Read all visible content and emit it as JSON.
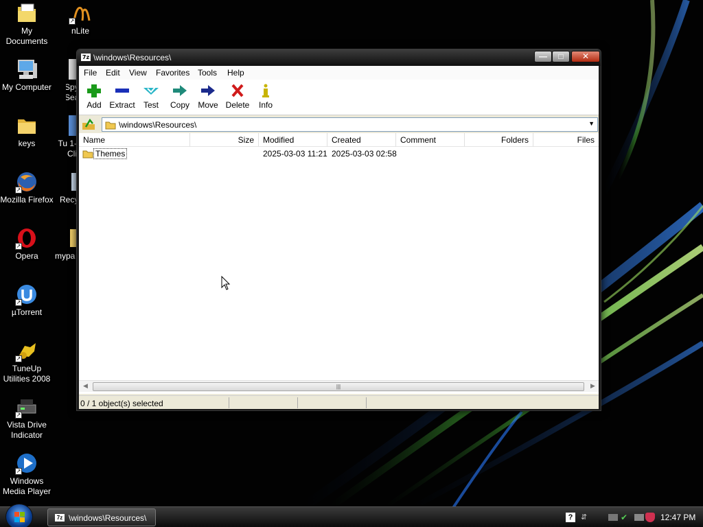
{
  "desktop": {
    "icons": [
      {
        "label": "My Documents",
        "icon": "my-documents-icon"
      },
      {
        "label": "nLite",
        "icon": "nlite-icon"
      },
      {
        "label": "My Computer",
        "icon": "my-computer-icon"
      },
      {
        "label": "Spy Sea",
        "icon": "spybot-icon"
      },
      {
        "label": "keys",
        "icon": "folder-icon"
      },
      {
        "label": "Tu 1-Cli",
        "icon": "tuneup-1click-icon"
      },
      {
        "label": "Mozilla Firefox",
        "icon": "firefox-icon"
      },
      {
        "label": "Recy",
        "icon": "recycle-bin-icon"
      },
      {
        "label": "Opera",
        "icon": "opera-icon"
      },
      {
        "label": "mypa",
        "icon": "folder-icon"
      },
      {
        "label": "µTorrent",
        "icon": "utorrent-icon"
      },
      {
        "label": "TuneUp Utilities 2008",
        "icon": "tuneup-utilities-icon"
      },
      {
        "label": "Vista Drive Indicator",
        "icon": "drive-indicator-icon"
      },
      {
        "label": "Windows Media Player",
        "icon": "media-player-icon"
      }
    ]
  },
  "window": {
    "app_icon_text": "7z",
    "title": "\\windows\\Resources\\",
    "buttons": {
      "minimize": "—",
      "maximize": "□",
      "close": "✕"
    },
    "menu": [
      "File",
      "Edit",
      "View",
      "Favorites",
      "Tools",
      "Help"
    ],
    "toolbar": [
      {
        "label": "Add",
        "icon": "add-icon",
        "color": "#1a9a1a"
      },
      {
        "label": "Extract",
        "icon": "extract-icon",
        "color": "#1a2fb8"
      },
      {
        "label": "Test",
        "icon": "test-icon",
        "color": "#2bb6c8"
      },
      {
        "label": "Copy",
        "icon": "copy-icon",
        "color": "#1f8a7a"
      },
      {
        "label": "Move",
        "icon": "move-icon",
        "color": "#1b2a8c"
      },
      {
        "label": "Delete",
        "icon": "delete-icon",
        "color": "#d01a1a"
      },
      {
        "label": "Info",
        "icon": "info-icon",
        "color": "#c8b400"
      }
    ],
    "address": {
      "path": "\\windows\\Resources\\"
    },
    "columns": [
      "Name",
      "Size",
      "Modified",
      "Created",
      "Comment",
      "Folders",
      "Files"
    ],
    "rows": [
      {
        "name": "Themes",
        "size": "",
        "modified": "2025-03-03 11:21",
        "created": "2025-03-03 02:58",
        "comment": "",
        "folders": "",
        "files": ""
      }
    ],
    "status": "0 / 1 object(s) selected"
  },
  "taskbar": {
    "task_label": "\\windows\\Resources\\",
    "clock": "12:47 PM"
  }
}
